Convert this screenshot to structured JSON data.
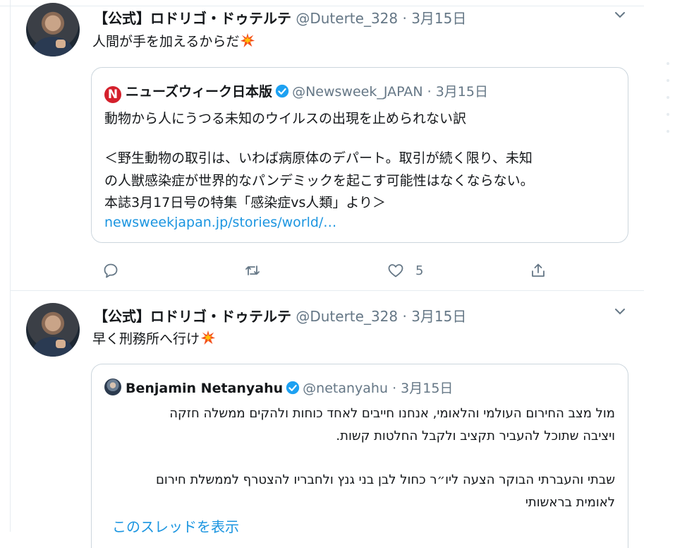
{
  "tweets": [
    {
      "author_name": "【公式】ロドリゴ・ドゥテルテ",
      "handle": "@Duterte_328",
      "separator": "·",
      "date": "3月15日",
      "text": "人間が手を加えるからだ",
      "emoji_icon": "collision-icon",
      "quote": {
        "author_name": "ニューズウィーク日本版",
        "logo_letter": "N",
        "handle": "@Newsweek_JAPAN",
        "separator": "·",
        "date": "3月15日",
        "lines": [
          "動物から人にうつる未知のウイルスの出現を止められない訳",
          "",
          "＜野生動物の取引は、いわば病原体のデパート。取引が続く限り、未知",
          "の人獣感染症が世界的なパンデミックを起こす可能性はなくならない。",
          "本誌3月17日号の特集「感染症vs人類」より＞",
          "newsweekjapan.jp/stories/world/…"
        ]
      },
      "actions": {
        "like_count": "5"
      }
    },
    {
      "author_name": "【公式】ロドリゴ・ドゥテルテ",
      "handle": "@Duterte_328",
      "separator": "·",
      "date": "3月15日",
      "text": "早く刑務所へ行け",
      "emoji_icon": "collision-icon",
      "quote": {
        "author_name": "Benjamin Netanyahu",
        "handle": "@netanyahu",
        "separator": "·",
        "date": "3月15日",
        "lines": [
          "מול מצב החירום העולמי והלאומי, אנחנו חייבים לאחד כוחות ולהקים ממשלה חזקה",
          "ויציבה שתוכל להעביר תקציב ולקבל החלטות קשות.",
          "שבתי והעברתי הבוקר הצעה ליו״ר כחול לבן בני גנץ ולחבריו להצטרף לממשלת חירום",
          "לאומית בראשותי"
        ]
      }
    }
  ],
  "show_thread": "このスレッドを表示",
  "colors": {
    "accent": "#1b95e0",
    "verified": "#1da1f2",
    "muted": "#657786",
    "border": "#ccd6dd"
  }
}
